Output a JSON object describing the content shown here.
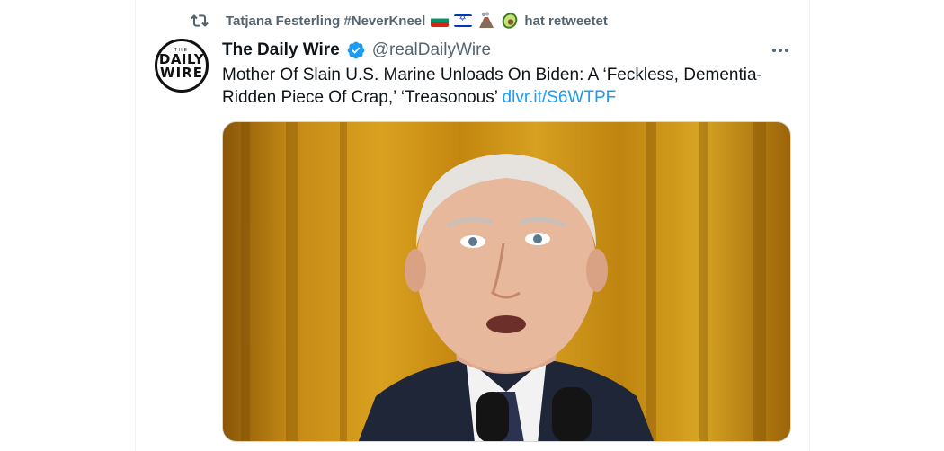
{
  "retweet_context": {
    "retweeter_name": "Tatjana Festerling #NeverKneel",
    "emojis": [
      "flag-bulgaria",
      "flag-israel",
      "volcano",
      "avocado"
    ],
    "label": "hat retweetet"
  },
  "tweet": {
    "avatar_text": {
      "top": "THE",
      "line1": "DAILY",
      "line2": "WIRE"
    },
    "display_name": "The Daily Wire",
    "verified": true,
    "handle": "@realDailyWire",
    "text": "Mother Of Slain U.S. Marine Unloads On Biden: A ‘Feckless, Dementia-Ridden Piece Of Crap,’ ‘Treasonous’ ",
    "link": "dlvr.it/S6WTPF",
    "media": {
      "alt": "Photo of Joe Biden speaking in front of a gold curtain with microphones"
    }
  },
  "colors": {
    "link": "#1d9bf0",
    "verified": "#1d9bf0",
    "secondary_text": "#536471",
    "border": "#eff3f4"
  }
}
